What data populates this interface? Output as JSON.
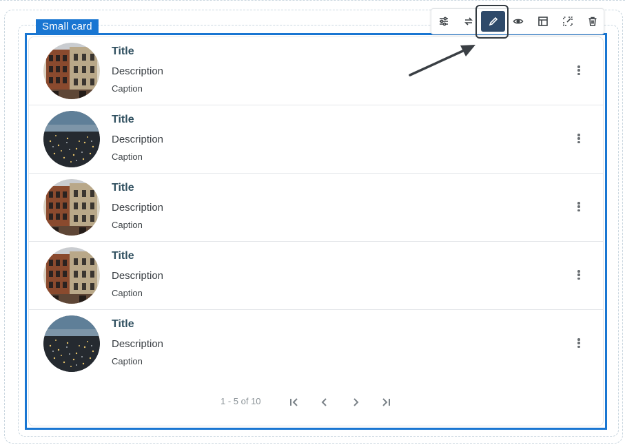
{
  "component": {
    "tag_label": "Small card"
  },
  "list": {
    "items": [
      {
        "title": "Title",
        "description": "Description",
        "caption": "Caption",
        "image": "building"
      },
      {
        "title": "Title",
        "description": "Description",
        "caption": "Caption",
        "image": "city"
      },
      {
        "title": "Title",
        "description": "Description",
        "caption": "Caption",
        "image": "building"
      },
      {
        "title": "Title",
        "description": "Description",
        "caption": "Caption",
        "image": "building"
      },
      {
        "title": "Title",
        "description": "Description",
        "caption": "Caption",
        "image": "city"
      }
    ]
  },
  "pagination": {
    "range_text": "1 - 5 of 10"
  },
  "toolbar": {
    "buttons": [
      {
        "icon": "sliders-icon"
      },
      {
        "icon": "swap-icon"
      },
      {
        "icon": "pencil-icon",
        "active": true
      },
      {
        "icon": "eye-icon"
      },
      {
        "icon": "layout-icon"
      },
      {
        "icon": "expand-icon"
      },
      {
        "icon": "trash-icon"
      }
    ]
  },
  "colors": {
    "selection": "#1976d2",
    "active_tool": "#2f4a6a",
    "title_text": "#2f4f5f",
    "dashed_outline": "#c9d6df"
  }
}
